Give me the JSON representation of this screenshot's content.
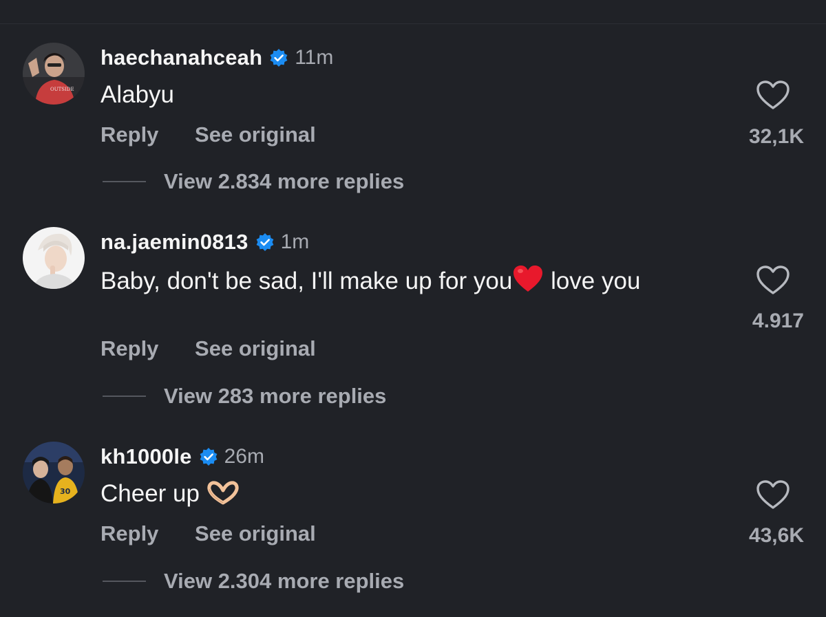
{
  "theme": {
    "background": "#202227",
    "verified_color": "#1b8cf2",
    "heart_emoji_color": "#e8192c",
    "muted_text": "#a8abb2"
  },
  "comments": [
    {
      "username": "haechanahceah",
      "verified": true,
      "time": "11m",
      "text": "Alabyu",
      "reply_label": "Reply",
      "see_original_label": "See original",
      "view_replies_label": "View 2.834 more replies",
      "like_count": "32,1K",
      "like_icon": "heart-outline-icon"
    },
    {
      "username": "na.jaemin0813",
      "verified": true,
      "time": "1m",
      "text_before_emoji": "Baby, don't be sad, I'll make up for you",
      "emoji": "red-heart",
      "text_after_emoji": " love you",
      "reply_label": "Reply",
      "see_original_label": "See original",
      "view_replies_label": "View 283 more replies",
      "like_count": "4.917",
      "like_icon": "heart-outline-icon"
    },
    {
      "username": "kh1000le",
      "verified": true,
      "time": "26m",
      "text": "Cheer up",
      "emoji": "heart-hands",
      "reply_label": "Reply",
      "see_original_label": "See original",
      "view_replies_label": "View 2.304 more replies",
      "like_count": "43,6K",
      "like_icon": "heart-outline-icon"
    }
  ]
}
